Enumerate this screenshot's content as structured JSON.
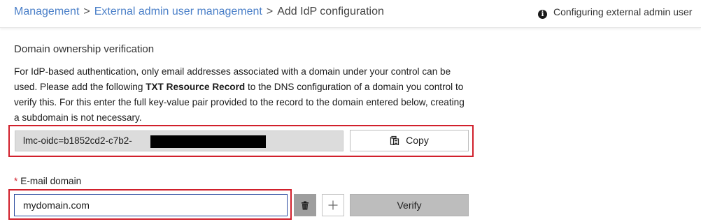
{
  "breadcrumb": {
    "items": [
      "Management",
      "External admin user management"
    ],
    "separator": ">",
    "current": "Add IdP configuration"
  },
  "status": {
    "icon": "info-icon",
    "text": "Configuring external admin user"
  },
  "section": {
    "title": "Domain ownership verification",
    "description_part1": "For IdP-based authentication, only email addresses associated with a domain under your control can be used. Please add the following ",
    "description_bold": "TXT Resource Record",
    "description_part2": " to the DNS configuration of a domain you control to verify this. For this enter the full key-value pair provided to the record to the domain entered below, creating a subdomain is not necessary."
  },
  "txt_record": {
    "value": "lmc-oidc=b1852cd2-c7b2-",
    "copy_label": "Copy",
    "copy_icon": "clipboard-icon"
  },
  "email_domain": {
    "required_marker": "*",
    "label": "E-mail domain",
    "value": "mydomain.com",
    "delete_icon": "trash-icon",
    "add_icon": "plus-icon",
    "verify_label": "Verify"
  },
  "colors": {
    "link": "#4a7fc8",
    "highlight": "#d1202c",
    "input_border": "#2a4a9e",
    "disabled_button": "#bdbdbd"
  }
}
